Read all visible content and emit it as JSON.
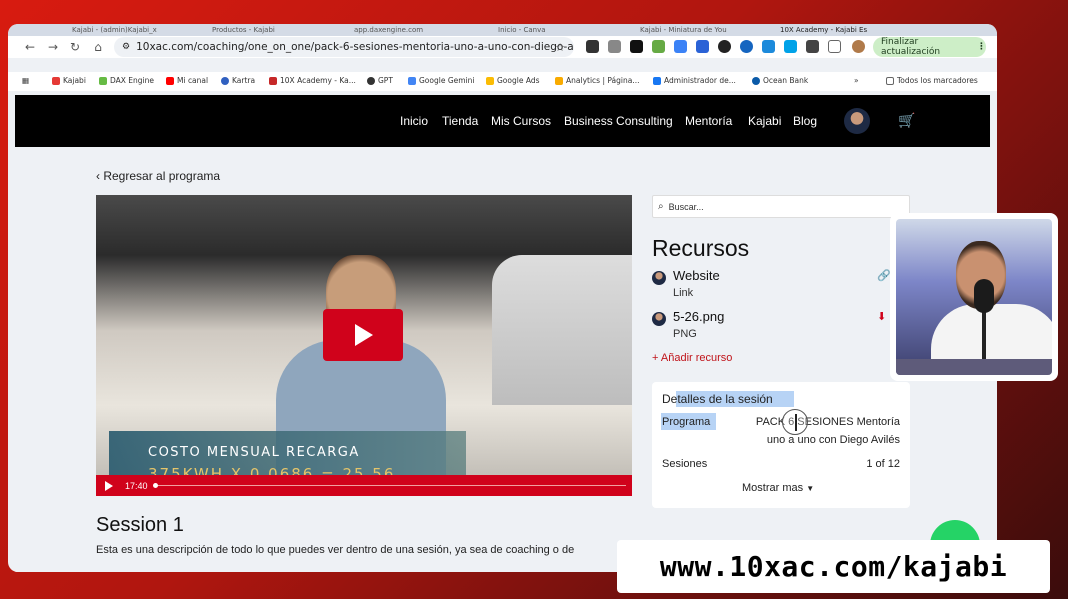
{
  "browser": {
    "tabs": [
      "Kajabi - (admin)Kajabi_x",
      "Productos - Kajabi",
      "app.daxengine.com",
      "Inicio - Canva",
      "Kajabi - Miniatura de You",
      "10X Academy - Kajabi Es"
    ],
    "url": "10xac.com/coaching/one_on_one/pack-6-sesiones-mentoria-uno-a-uno-con-diego-aviles/se...",
    "update_label": "Finalizar actualización",
    "bookmarks": [
      "Kajabi",
      "DAX Engine",
      "Mi canal",
      "Kartra",
      "10X Academy - Ka...",
      "GPT",
      "Google Gemini",
      "Google Ads",
      "Analytics | Página...",
      "Administrador de...",
      "Ocean Bank",
      "Todos los marcadores"
    ],
    "colors": {
      "accent": "#d0021b",
      "update_bg": "#cdeec7"
    }
  },
  "site": {
    "nav": [
      "Inicio",
      "Tienda",
      "Mis Cursos",
      "Business Consulting",
      "Mentoría",
      "Kajabi",
      "Blog"
    ]
  },
  "page": {
    "back_link": "‹ Regresar al programa",
    "video": {
      "time": "17:40",
      "overlay_line1": "COSTO MENSUAL RECARGA",
      "overlay_line2": "375KWH X 0.0686 = 25.56"
    },
    "session_title": "Session 1",
    "session_description": "Esta es una descripción de todo lo que puedes ver dentro de una sesión, ya sea de coaching o de"
  },
  "sidebar": {
    "search_placeholder": "Buscar...",
    "resources_title": "Recursos",
    "resources": [
      {
        "name": "Website",
        "type": "Link",
        "action_icon": "link-icon"
      },
      {
        "name": "5-26.png",
        "type": "PNG",
        "action_icon": "download-icon"
      }
    ],
    "add_resource": "+ Añadir recurso",
    "details": {
      "title": "Detalles de la sesión",
      "program_label": "Programa",
      "program_value_line1": "PACK 6 SESIONES Mentoría",
      "program_value_line2": "uno a uno con Diego Avilés",
      "sessions_label": "Sesiones",
      "sessions_value": "1 of 12",
      "show_more": "Mostrar mas"
    }
  },
  "banner": {
    "text": "www.10xac.com/kajabi"
  }
}
